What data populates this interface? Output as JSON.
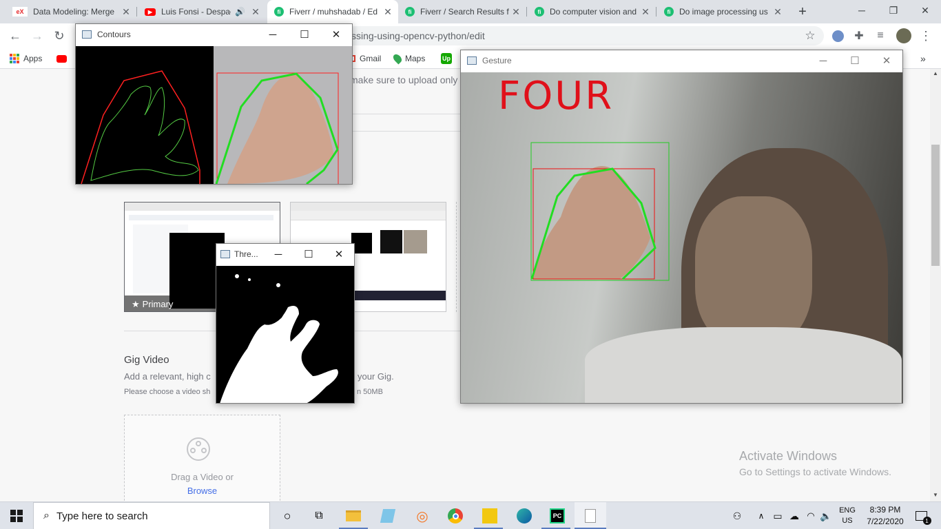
{
  "browser": {
    "tabs": [
      {
        "title": "Data Modeling: Merge",
        "icon": "edx-icon",
        "color": "#e6282b"
      },
      {
        "title": "Luis Fonsi - Despac",
        "icon": "youtube-icon",
        "color": "#ff0000"
      },
      {
        "title": "Fiverr / muhshadab / Ed",
        "icon": "fiverr-icon",
        "color": "#1dbf73"
      },
      {
        "title": "Fiverr / Search Results f",
        "icon": "fiverr-icon",
        "color": "#1dbf73"
      },
      {
        "title": "Do computer vision and",
        "icon": "fiverr-icon",
        "color": "#1dbf73"
      },
      {
        "title": "Do image processing us",
        "icon": "fiverr-icon",
        "color": "#1dbf73"
      }
    ],
    "url_visible": "ssing-using-opencv-python/edit",
    "bookmarks": {
      "apps": "Apps",
      "gmail": "Gmail",
      "maps": "Maps"
    }
  },
  "page": {
    "notice_partial": "make sure to upload only c",
    "primary_badge": "Primary",
    "gig_video": {
      "title": "Gig Video",
      "desc_left": "Add a relevant, high c",
      "desc_right": "your Gig.",
      "note_left": "Please choose a video sh",
      "note_right": "n 50MB",
      "drag_text": "Drag a Video or",
      "browse": "Browse"
    }
  },
  "windows": {
    "contours": {
      "title": "Contours"
    },
    "threshold": {
      "title": "Thre..."
    },
    "gesture": {
      "title": "Gesture",
      "label": "FOUR",
      "label_color": "#e0101a"
    }
  },
  "watermark": {
    "line1": "Activate Windows",
    "line2": "Go to Settings to activate Windows."
  },
  "taskbar": {
    "search_placeholder": "Type here to search",
    "lang1": "ENG",
    "lang2": "US",
    "time": "8:39 PM",
    "date": "7/22/2020",
    "notifications": "1"
  }
}
